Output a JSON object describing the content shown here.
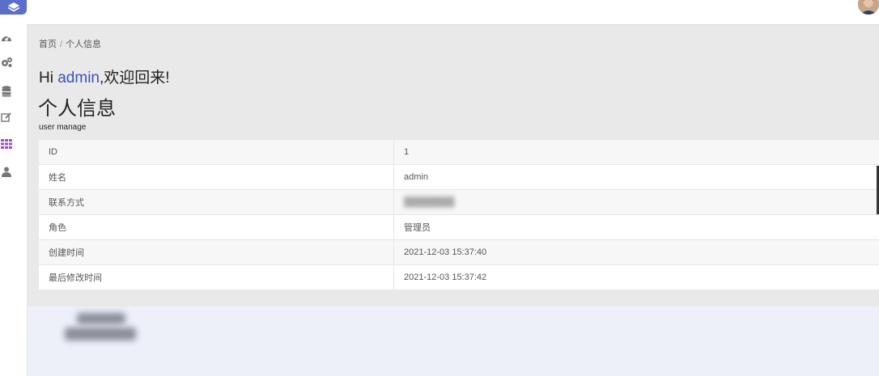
{
  "breadcrumb": {
    "home": "首页",
    "separator": "/",
    "current": "个人信息"
  },
  "greeting": {
    "prefix": "Hi ",
    "username": "admin",
    "suffix": ",欢迎回来!"
  },
  "page": {
    "title": "个人信息",
    "subtitle": "user manage"
  },
  "table": {
    "rows": [
      {
        "label": "ID",
        "value": "1"
      },
      {
        "label": "姓名",
        "value": "admin"
      },
      {
        "label": "联系方式",
        "value": ""
      },
      {
        "label": "角色",
        "value": "管理员"
      },
      {
        "label": "创建时间",
        "value": "2021-12-03 15:37:40"
      },
      {
        "label": "最后修改时间",
        "value": "2021-12-03 15:37:42"
      }
    ]
  },
  "sidebar": {
    "icons": [
      "dashboard-icon",
      "settings-icon",
      "database-icon",
      "edit-icon",
      "grid-icon",
      "user-icon"
    ]
  },
  "colors": {
    "accent": "#5b6ec9",
    "username": "#3d52b5",
    "grid_icon": "#a34ec9"
  }
}
